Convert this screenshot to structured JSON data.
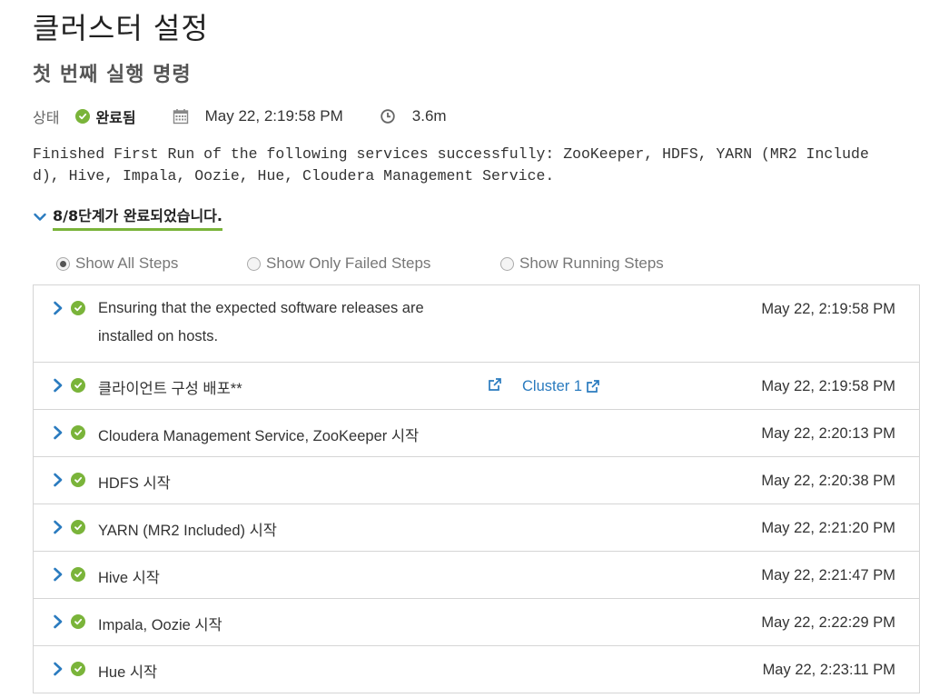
{
  "page_title": "클러스터 설정",
  "subtitle": "첫 번째 실행 명령",
  "status": {
    "label": "상태",
    "value": "완료됨",
    "date": "May 22, 2:19:58 PM",
    "duration": "3.6m"
  },
  "summary": "Finished First Run of the following services successfully: ZooKeeper, HDFS, YARN (MR2 Included), Hive, Impala, Oozie, Hue, Cloudera Management Service.",
  "steps_toggle_label": "8/8단계가 완료되었습니다.",
  "filters": [
    {
      "label": "Show All Steps",
      "checked": true
    },
    {
      "label": "Show Only Failed Steps",
      "checked": false
    },
    {
      "label": "Show Running Steps",
      "checked": false
    }
  ],
  "steps": [
    {
      "name": "Ensuring that the expected software releases are installed on hosts.",
      "time": "May 22, 2:19:58 PM"
    },
    {
      "name": "클라이언트 구성 배포**",
      "time": "May 22, 2:19:58 PM",
      "link": "Cluster 1"
    },
    {
      "name": "Cloudera Management Service, ZooKeeper 시작",
      "time": "May 22, 2:20:13 PM"
    },
    {
      "name": "HDFS 시작",
      "time": "May 22, 2:20:38 PM"
    },
    {
      "name": "YARN (MR2 Included) 시작",
      "time": "May 22, 2:21:20 PM"
    },
    {
      "name": "Hive 시작",
      "time": "May 22, 2:21:47 PM"
    },
    {
      "name": "Impala, Oozie 시작",
      "time": "May 22, 2:22:29 PM"
    },
    {
      "name": "Hue 시작",
      "time": "May 22, 2:23:11 PM"
    }
  ],
  "colors": {
    "success": "#7ab43a",
    "link": "#2a7bbf",
    "chevron": "#2a7bbf"
  }
}
